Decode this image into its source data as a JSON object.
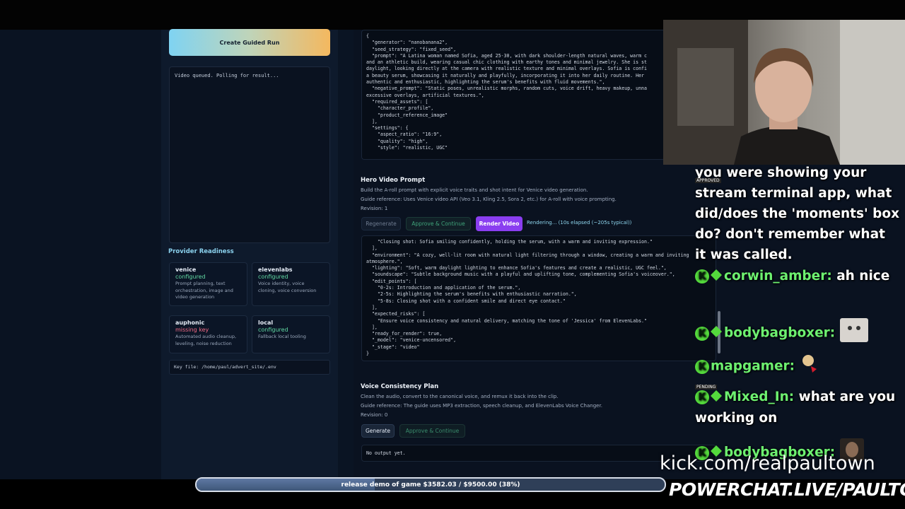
{
  "left_panel": {
    "guided_button_label": "Create Guided Run",
    "log_text": "Video queued. Polling for result...",
    "provider_heading": "Provider Readiness",
    "providers": [
      {
        "name": "venice",
        "status": "configured",
        "state": "ok",
        "desc": "Prompt planning, text orchestration, image and video generation"
      },
      {
        "name": "elevenlabs",
        "status": "configured",
        "state": "ok",
        "desc": "Voice identity, voice cloning, voice conversion"
      },
      {
        "name": "auphonic",
        "status": "missing key",
        "state": "bad",
        "desc": "Automated audio cleanup, leveling, noise reduction"
      },
      {
        "name": "local",
        "status": "configured",
        "state": "ok",
        "desc": "Fallback local tooling"
      }
    ],
    "key_file": "Key file: /home/paul/advert_site/.env"
  },
  "image_prompt_code": "{\n  \"generator\": \"nanobanana2\",\n  \"seed_strategy\": \"fixed_seed\",\n  \"prompt\": \"A Latina woman named Sofia, aged 25-30, with dark shoulder-length natural waves, warm c\nand an athletic build, wearing casual chic clothing with earthy tones and minimal jewelry. She is st\ndaylight, looking directly at the camera with realistic texture and minimal overlays. Sofia is confi\na beauty serum, showcasing it naturally and playfully, incorporating it into her daily routine. Her\nauthentic and enthusiastic, highlighting the serum's benefits with fluid movements.\",\n  \"negative_prompt\": \"Static poses, unrealistic morphs, random cuts, voice drift, heavy makeup, unna\nexcessive overlays, artificial textures.\",\n  \"required_assets\": [\n    \"character_profile\",\n    \"product_reference_image\"\n  ],\n  \"settings\": {\n    \"aspect_ratio\": \"16:9\",\n    \"quality\": \"high\",\n    \"style\": \"realistic, UGC\"",
  "hero_panel": {
    "title": "Hero Video Prompt",
    "description": "Build the A-roll prompt with explicit voice traits and shot intent for Venice video generation.",
    "guide": "Guide reference: Uses Venice video API (Veo 3.1, Kling 2.5, Sora 2, etc.) for A-roll with voice prompting.",
    "revision": "Revision: 1",
    "regenerate_label": "Regenerate",
    "approve_label": "Approve & Continue",
    "render_label": "Render Video",
    "render_status": "Rendering... (10s elapsed (~205s typical))",
    "code": "    \"Closing shot: Sofia smiling confidently, holding the serum, with a warm and inviting expression.\"\n  ],\n  \"environment\": \"A cozy, well-lit room with natural light filtering through a window, creating a warm and inviting\natmosphere.\",\n  \"lighting\": \"Soft, warm daylight lighting to enhance Sofia's features and create a realistic, UGC feel.\",\n  \"soundscape\": \"Subtle background music with a playful and uplifting tone, complementing Sofia's voiceover.\",\n  \"edit_points\": [\n    \"0-2s: Introduction and application of the serum.\",\n    \"2-5s: Highlighting the serum's benefits with enthusiastic narration.\",\n    \"5-8s: Closing shot with a confident smile and direct eye contact.\"\n  ],\n  \"expected_risks\": [\n    \"Ensure voice consistency and natural delivery, matching the tone of 'Jessica' from ElevenLabs.\"\n  ],\n  \"ready_for_render\": true,\n  \"_model\": \"venice-uncensored\",\n  \"_stage\": \"video\"\n}"
  },
  "voice_panel": {
    "title": "Voice Consistency Plan",
    "description": "Clean the audio, convert to the canonical voice, and remux it back into the clip.",
    "guide": "Guide reference: The guide uses MP3 extraction, speech cleanup, and ElevenLabs Voice Changer.",
    "revision": "Revision: 0",
    "generate_label": "Generate",
    "approve_label": "Approve & Continue",
    "output": "No output yet."
  },
  "chat": {
    "messages": [
      {
        "user": "",
        "text": "you were showing your stream terminal app, what did/does the 'moments' box do? don't remember what it was called."
      },
      {
        "user": "corwin_amber:",
        "text": "ah nice"
      },
      {
        "user": "bodybagboxer:",
        "text": ""
      },
      {
        "user": "mapgamer:",
        "text": ""
      },
      {
        "user": "Mixed_In:",
        "text": "what are you working on"
      },
      {
        "user": "bodybagboxer:",
        "text": ""
      }
    ],
    "tag_approved": "APPROVED",
    "tag_pending": "PENDING"
  },
  "overlay": {
    "kick_url": "kick.com/realpaultown",
    "powerchat": "POWERCHAT.LIVE/PAULTOWN",
    "goal_text": "release demo of game $3582.03 / $9500.00 (38%)",
    "goal_fraction": 0.38,
    "goal_current": 3582.03,
    "goal_target": 9500.0
  },
  "colors": {
    "accent_purple": "#8a3ef0",
    "ok_green": "#61d8a3",
    "error_pink": "#f36b86",
    "chat_user_green": "#6df070"
  }
}
